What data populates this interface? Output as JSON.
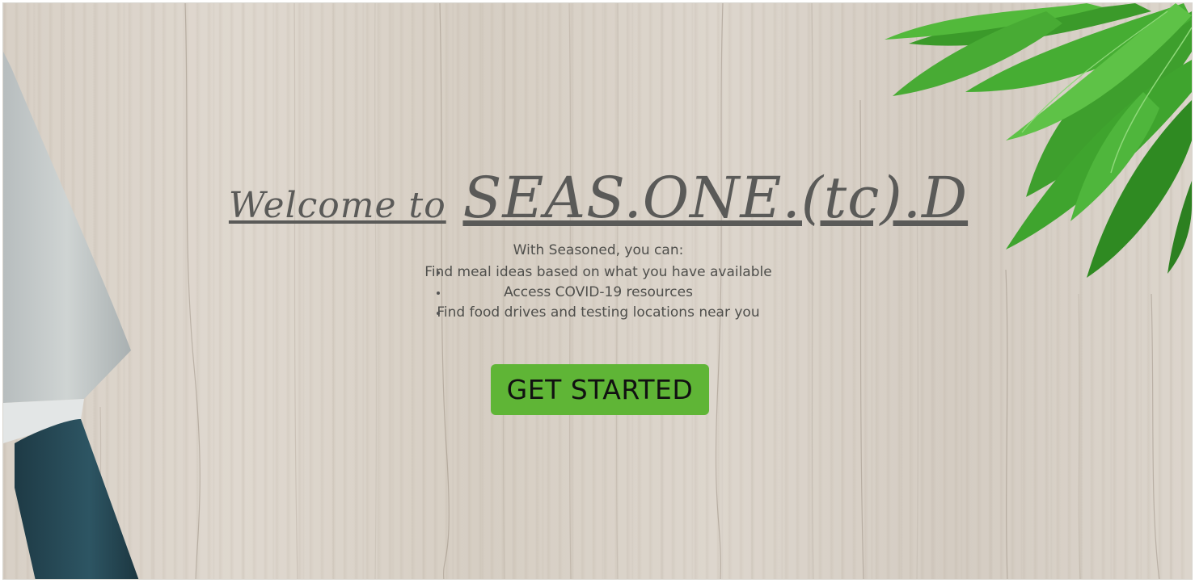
{
  "hero": {
    "title_part1": "Welcome to",
    "title_part2": "SEAS.ONE.(tc).D",
    "intro": "With Seasoned, you can:",
    "features": [
      "Find meal ideas based on what you have available",
      "Access COVID-19 resources",
      "Find food drives and testing locations near you"
    ],
    "cta_label": "GET STARTED"
  },
  "colors": {
    "cta_background": "#5fb536",
    "text": "#4f4f4c",
    "title": "#5a5a58",
    "wood": "#d8d0c6"
  },
  "icons": {
    "knife": "knife-image",
    "leaves": "leaves-image"
  }
}
